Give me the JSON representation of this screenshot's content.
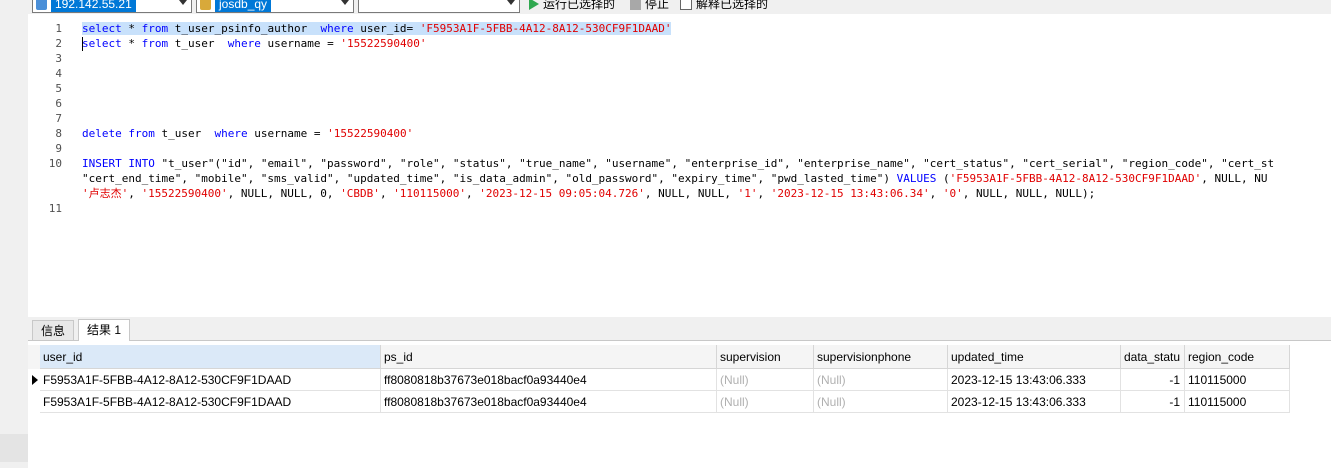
{
  "toolbar": {
    "connection": "192.142.55.21",
    "database": "josdb_qy",
    "empty_combo": "",
    "run_selected_label": "运行已选择的",
    "stop_label": "停止",
    "explain_selected_label": "解释已选择的"
  },
  "editor": {
    "line_numbers": [
      "1",
      "2",
      "3",
      "4",
      "5",
      "6",
      "7",
      "8",
      "9",
      "10",
      "",
      "",
      "11"
    ],
    "lines": [
      [
        {
          "t": "select",
          "c": "kw"
        },
        {
          "t": " * "
        },
        {
          "t": "from",
          "c": "kw"
        },
        {
          "t": " t_user_psinfo_author  "
        },
        {
          "t": "where",
          "c": "kw"
        },
        {
          "t": " user_id= "
        },
        {
          "t": "'F5953A1F-5FBB-4A12-8A12-530CF9F1DAAD'",
          "c": "str"
        }
      ],
      [
        {
          "t": "select",
          "c": "kw"
        },
        {
          "t": " * "
        },
        {
          "t": "from",
          "c": "kw"
        },
        {
          "t": " t_user  "
        },
        {
          "t": "where",
          "c": "kw"
        },
        {
          "t": " username = "
        },
        {
          "t": "'15522590400'",
          "c": "str"
        }
      ],
      [],
      [],
      [],
      [],
      [],
      [
        {
          "t": "delete",
          "c": "kw"
        },
        {
          "t": " "
        },
        {
          "t": "from",
          "c": "kw"
        },
        {
          "t": " t_user  "
        },
        {
          "t": "where",
          "c": "kw"
        },
        {
          "t": " username = "
        },
        {
          "t": "'15522590400'",
          "c": "str"
        }
      ],
      [],
      [
        {
          "t": "INSERT INTO",
          "c": "kw"
        },
        {
          "t": " \"t_user\"(\"id\", \"email\", \"password\", \"role\", \"status\", \"true_name\", \"username\", \"enterprise_id\", \"enterprise_name\", \"cert_status\", \"cert_serial\", \"region_code\", \"cert_st"
        }
      ],
      [
        {
          "t": "\"cert_end_time\", \"mobile\", \"sms_valid\", \"updated_time\", \"is_data_admin\", \"old_password\", \"expiry_time\", \"pwd_lasted_time\") "
        },
        {
          "t": "VALUES",
          "c": "kw"
        },
        {
          "t": " ("
        },
        {
          "t": "'F5953A1F-5FBB-4A12-8A12-530CF9F1DAAD'",
          "c": "str"
        },
        {
          "t": ", NULL, NU"
        }
      ],
      [
        {
          "t": "'卢志杰'",
          "c": "str"
        },
        {
          "t": ", "
        },
        {
          "t": "'15522590400'",
          "c": "str"
        },
        {
          "t": ", NULL, NULL, 0, "
        },
        {
          "t": "'CBDB'",
          "c": "str"
        },
        {
          "t": ", "
        },
        {
          "t": "'110115000'",
          "c": "str"
        },
        {
          "t": ", "
        },
        {
          "t": "'2023-12-15 09:05:04.726'",
          "c": "str"
        },
        {
          "t": ", NULL, NULL, "
        },
        {
          "t": "'1'",
          "c": "str"
        },
        {
          "t": ", "
        },
        {
          "t": "'2023-12-15 13:43:06.34'",
          "c": "str"
        },
        {
          "t": ", "
        },
        {
          "t": "'0'",
          "c": "str"
        },
        {
          "t": ", NULL, NULL, NULL);"
        }
      ],
      []
    ]
  },
  "tabs": [
    {
      "label": "信息",
      "active": false
    },
    {
      "label": "结果 1",
      "active": true
    }
  ],
  "grid": {
    "columns": [
      "user_id",
      "ps_id",
      "supervision",
      "supervisionphone",
      "updated_time",
      "data_statu",
      "region_code"
    ],
    "rows": [
      [
        "F5953A1F-5FBB-4A12-8A12-530CF9F1DAAD",
        "ff8080818b37673e018bacf0a93440e4",
        "(Null)",
        "(Null)",
        "2023-12-15 13:43:06.333",
        "-1",
        "110115000"
      ],
      [
        "F5953A1F-5FBB-4A12-8A12-530CF9F1DAAD",
        "ff8080818b37673e018bacf0a93440e4",
        "(Null)",
        "(Null)",
        "2023-12-15 13:43:06.333",
        "-1",
        "110115000"
      ]
    ]
  },
  "colors": {
    "keyword": "#0000ff",
    "string": "#e00000",
    "selection": "#c8e1fb",
    "run_icon": "#2fa84f"
  },
  "icons": {
    "connection": "server-icon",
    "database": "database-icon",
    "run": "play-icon",
    "stop": "stop-icon",
    "explain": "explain-icon",
    "current_row": "row-pointer-icon"
  }
}
